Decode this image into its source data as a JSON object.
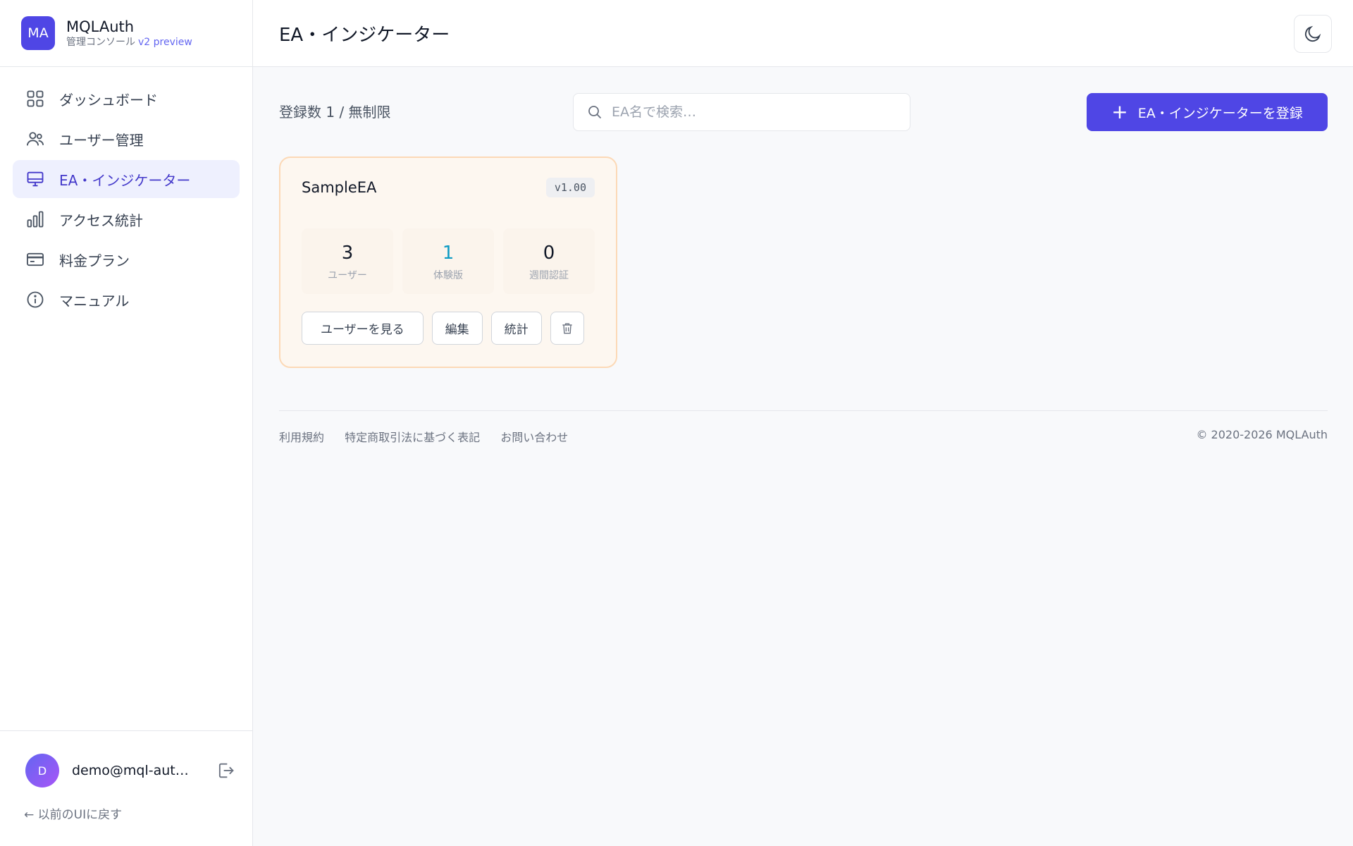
{
  "brand": {
    "logo_text": "MA",
    "name": "MQLAuth",
    "subtitle": "管理コンソール",
    "version": "v2 preview"
  },
  "nav": {
    "items": [
      {
        "label": "ダッシュボード",
        "icon": "grid-icon"
      },
      {
        "label": "ユーザー管理",
        "icon": "users-icon"
      },
      {
        "label": "EA・インジケーター",
        "icon": "monitor-icon",
        "active": true
      },
      {
        "label": "アクセス統計",
        "icon": "bar-chart-icon"
      },
      {
        "label": "料金プラン",
        "icon": "credit-card-icon"
      },
      {
        "label": "マニュアル",
        "icon": "info-icon"
      }
    ]
  },
  "user": {
    "avatar_letter": "D",
    "email": "demo@mql-aut…",
    "back_link": "← 以前のUIに戻す"
  },
  "header": {
    "title": "EA・インジケーター"
  },
  "toolbar": {
    "count_text": "登録数 1 / 無制限",
    "search_placeholder": "EA名で検索…",
    "add_button": "EA・インジケーターを登録"
  },
  "cards": [
    {
      "name": "SampleEA",
      "version": "v1.00",
      "stats": [
        {
          "value": "3",
          "label": "ユーザー"
        },
        {
          "value": "1",
          "label": "体験版"
        },
        {
          "value": "0",
          "label": "週間認証"
        }
      ],
      "actions": {
        "view_users": "ユーザーを見る",
        "edit": "編集",
        "stats": "統計"
      }
    }
  ],
  "footer": {
    "links": [
      "利用規約",
      "特定商取引法に基づく表記",
      "お問い合わせ"
    ],
    "copyright": "© 2020-2026 MQLAuth"
  },
  "colors": {
    "accent": "#4f46e5",
    "active_nav_bg": "#eef0fe",
    "card_border": "#fcd9b6",
    "trial_value": "#0e9bc4"
  }
}
